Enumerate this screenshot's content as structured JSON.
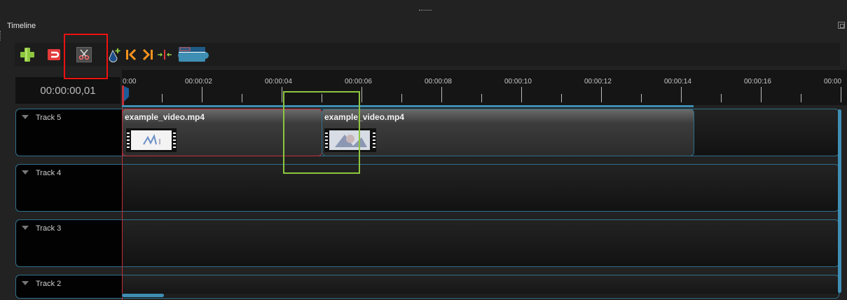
{
  "panel": {
    "title": "Timeline"
  },
  "toolbar": {
    "items": [
      {
        "name": "add-track",
        "icon": "plus-icon"
      },
      {
        "name": "snapping",
        "icon": "magnet-icon"
      },
      {
        "name": "razor",
        "icon": "scissors-icon"
      },
      {
        "name": "add-marker",
        "icon": "marker-add-icon"
      },
      {
        "name": "previous-marker",
        "icon": "jump-start-icon"
      },
      {
        "name": "next-marker",
        "icon": "jump-end-icon"
      },
      {
        "name": "center-playhead",
        "icon": "center-icon"
      },
      {
        "name": "zoom",
        "icon": "zoom-slider-icon"
      }
    ]
  },
  "colors": {
    "accent": "#3f8eb3",
    "highlight_red": "#ee1111",
    "highlight_green": "#8dc63f",
    "plus_green": "#8dc63f",
    "marker_orange": "#f7931e",
    "playhead": "#c0303a"
  },
  "timecode": "00:00:00,01",
  "ruler": {
    "labels": [
      "0:00",
      "00:00:02",
      "00:00:04",
      "00:00:06",
      "00:00:08",
      "00:00:10",
      "00:00:12",
      "00:00:14",
      "00:00:16",
      "00:00"
    ]
  },
  "tracks": [
    {
      "label": "Track 5"
    },
    {
      "label": "Track 4"
    },
    {
      "label": "Track 3"
    },
    {
      "label": "Track 2"
    }
  ],
  "clips": [
    {
      "title": "example_video.mp4",
      "track": "Track 5"
    },
    {
      "title": "example_video.mp4",
      "track": "Track 5"
    }
  ]
}
